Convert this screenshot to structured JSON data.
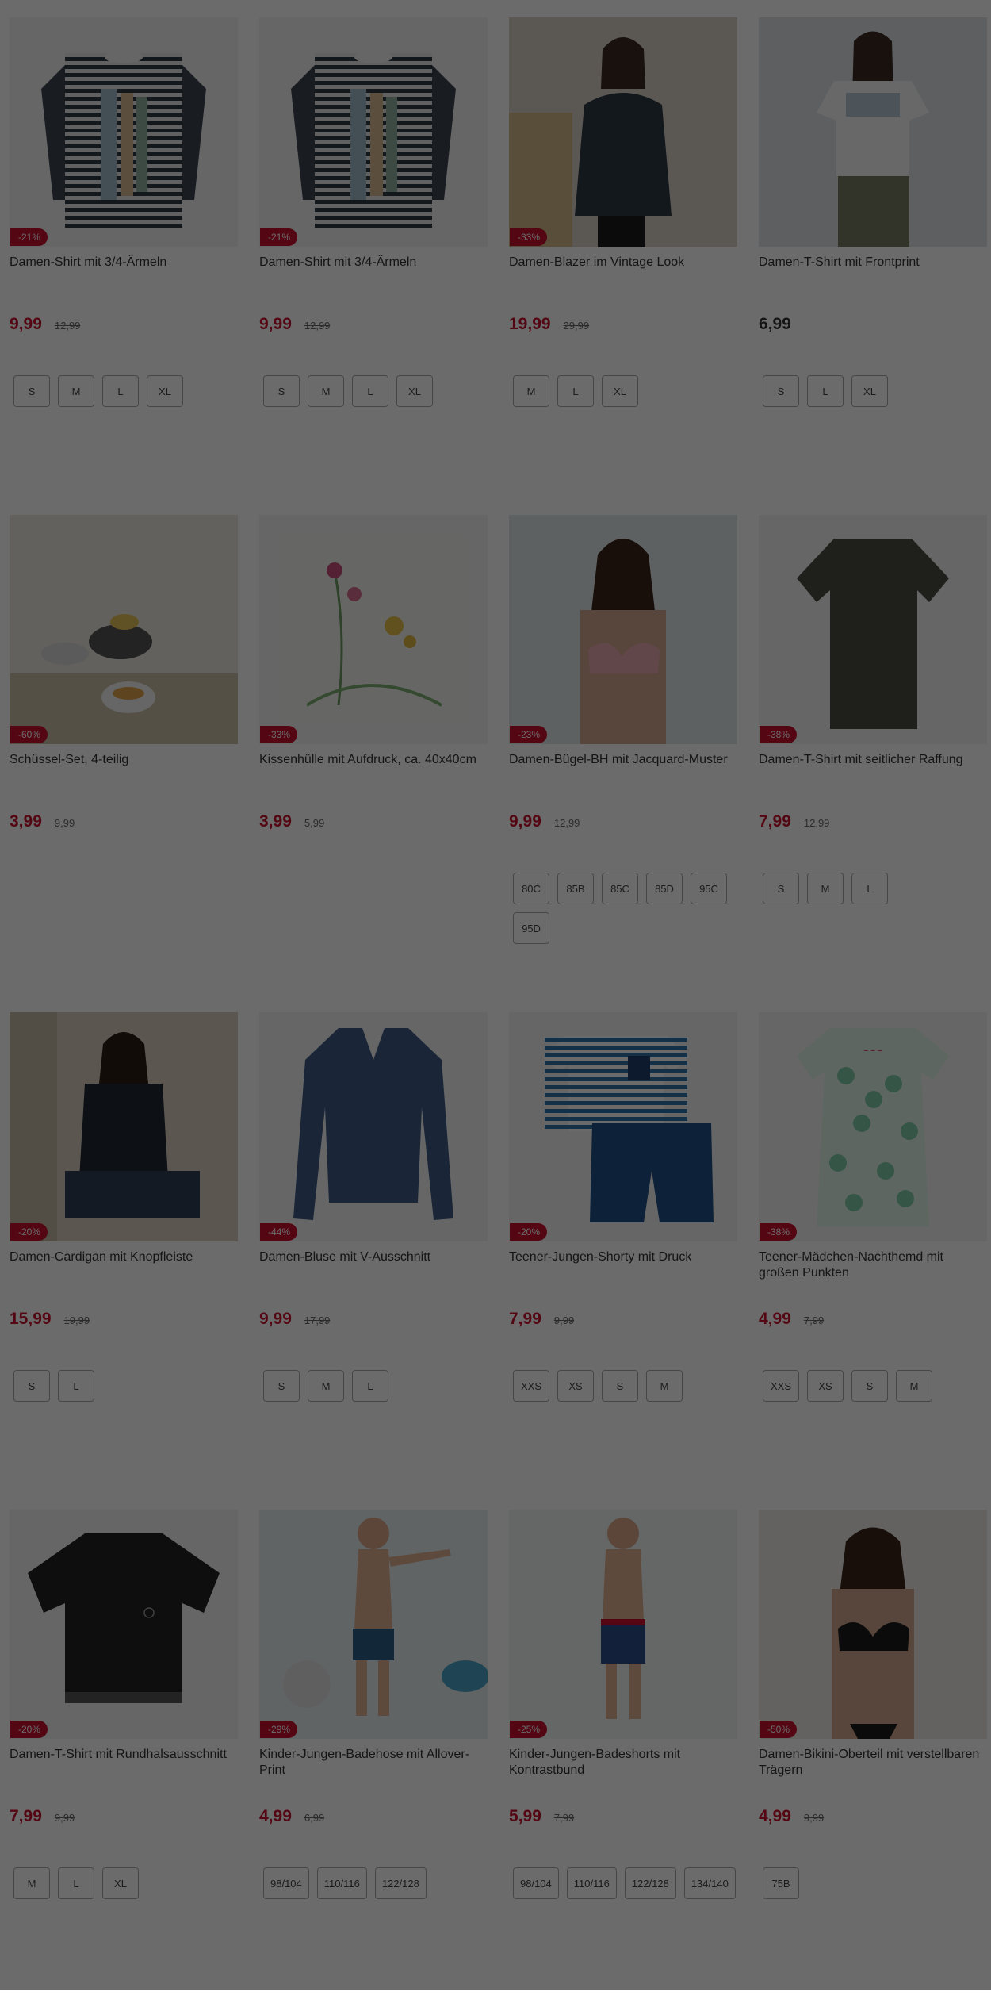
{
  "colors": {
    "sale_red": "#c8102e",
    "overlay": "rgba(0,0,0,0.58)"
  },
  "products": [
    {
      "title": "Damen-Shirt mit 3/4-Ärmeln",
      "badge": "-21%",
      "price": "9,99",
      "old": "12,99",
      "sizes": [
        "S",
        "M",
        "L",
        "XL"
      ],
      "image": "striped-shirt"
    },
    {
      "title": "Damen-Shirt mit 3/4-Ärmeln",
      "badge": "-21%",
      "price": "9,99",
      "old": "12,99",
      "sizes": [
        "S",
        "M",
        "L",
        "XL"
      ],
      "image": "striped-shirt"
    },
    {
      "title": "Damen-Blazer im Vintage Look",
      "badge": "-33%",
      "price": "19,99",
      "old": "29,99",
      "sizes": [
        "M",
        "L",
        "XL"
      ],
      "image": "blazer"
    },
    {
      "title": "Damen-T-Shirt mit Frontprint",
      "badge": "",
      "price": "6,99",
      "old": "",
      "sizes": [
        "S",
        "L",
        "XL"
      ],
      "image": "white-tshirt"
    },
    {
      "title": "Schüssel-Set, 4-teilig",
      "badge": "-60%",
      "price": "3,99",
      "old": "9,99",
      "sizes": [],
      "image": "bowls"
    },
    {
      "title": "Kissenhülle mit Aufdruck, ca. 40x40cm",
      "badge": "-33%",
      "price": "3,99",
      "old": "5,99",
      "sizes": [],
      "image": "pillow"
    },
    {
      "title": "Damen-Bügel-BH mit Jacquard-Muster",
      "badge": "-23%",
      "price": "9,99",
      "old": "12,99",
      "sizes": [
        "80C",
        "85B",
        "85C",
        "85D",
        "95C",
        "95D"
      ],
      "image": "bra"
    },
    {
      "title": "Damen-T-Shirt mit seitlicher Raffung",
      "badge": "-38%",
      "price": "7,99",
      "old": "12,99",
      "sizes": [
        "S",
        "M",
        "L"
      ],
      "image": "dark-tshirt"
    },
    {
      "title": "Damen-Cardigan mit Knopfleiste",
      "badge": "-20%",
      "price": "15,99",
      "old": "19,99",
      "sizes": [
        "S",
        "L"
      ],
      "image": "cardigan"
    },
    {
      "title": "Damen-Bluse mit V-Ausschnitt",
      "badge": "-44%",
      "price": "9,99",
      "old": "17,99",
      "sizes": [
        "S",
        "M",
        "L"
      ],
      "image": "blouse"
    },
    {
      "title": "Teener-Jungen-Shorty mit Druck",
      "badge": "-20%",
      "price": "7,99",
      "old": "9,99",
      "sizes": [
        "XXS",
        "XS",
        "S",
        "M"
      ],
      "image": "shorty"
    },
    {
      "title": "Teener-Mädchen-Nachthemd mit großen Punkten",
      "badge": "-38%",
      "price": "4,99",
      "old": "7,99",
      "sizes": [
        "XXS",
        "XS",
        "S",
        "M"
      ],
      "image": "nightgown"
    },
    {
      "title": "Damen-T-Shirt mit Rundhalsausschnitt",
      "badge": "-20%",
      "price": "7,99",
      "old": "9,99",
      "sizes": [
        "M",
        "L",
        "XL"
      ],
      "image": "black-tshirt"
    },
    {
      "title": "Kinder-Jungen-Badehose mit Allover-Print",
      "badge": "-29%",
      "price": "4,99",
      "old": "6,99",
      "sizes": [
        "98/104",
        "110/116",
        "122/128"
      ],
      "image": "kid-swim"
    },
    {
      "title": "Kinder-Jungen-Badeshorts mit Kontrastbund",
      "badge": "-25%",
      "price": "5,99",
      "old": "7,99",
      "sizes": [
        "98/104",
        "110/116",
        "122/128",
        "134/140"
      ],
      "image": "kid-shorts"
    },
    {
      "title": "Damen-Bikini-Oberteil mit verstellbaren Trägern",
      "badge": "-50%",
      "price": "4,99",
      "old": "9,99",
      "sizes": [
        "75B"
      ],
      "image": "bikini"
    }
  ]
}
